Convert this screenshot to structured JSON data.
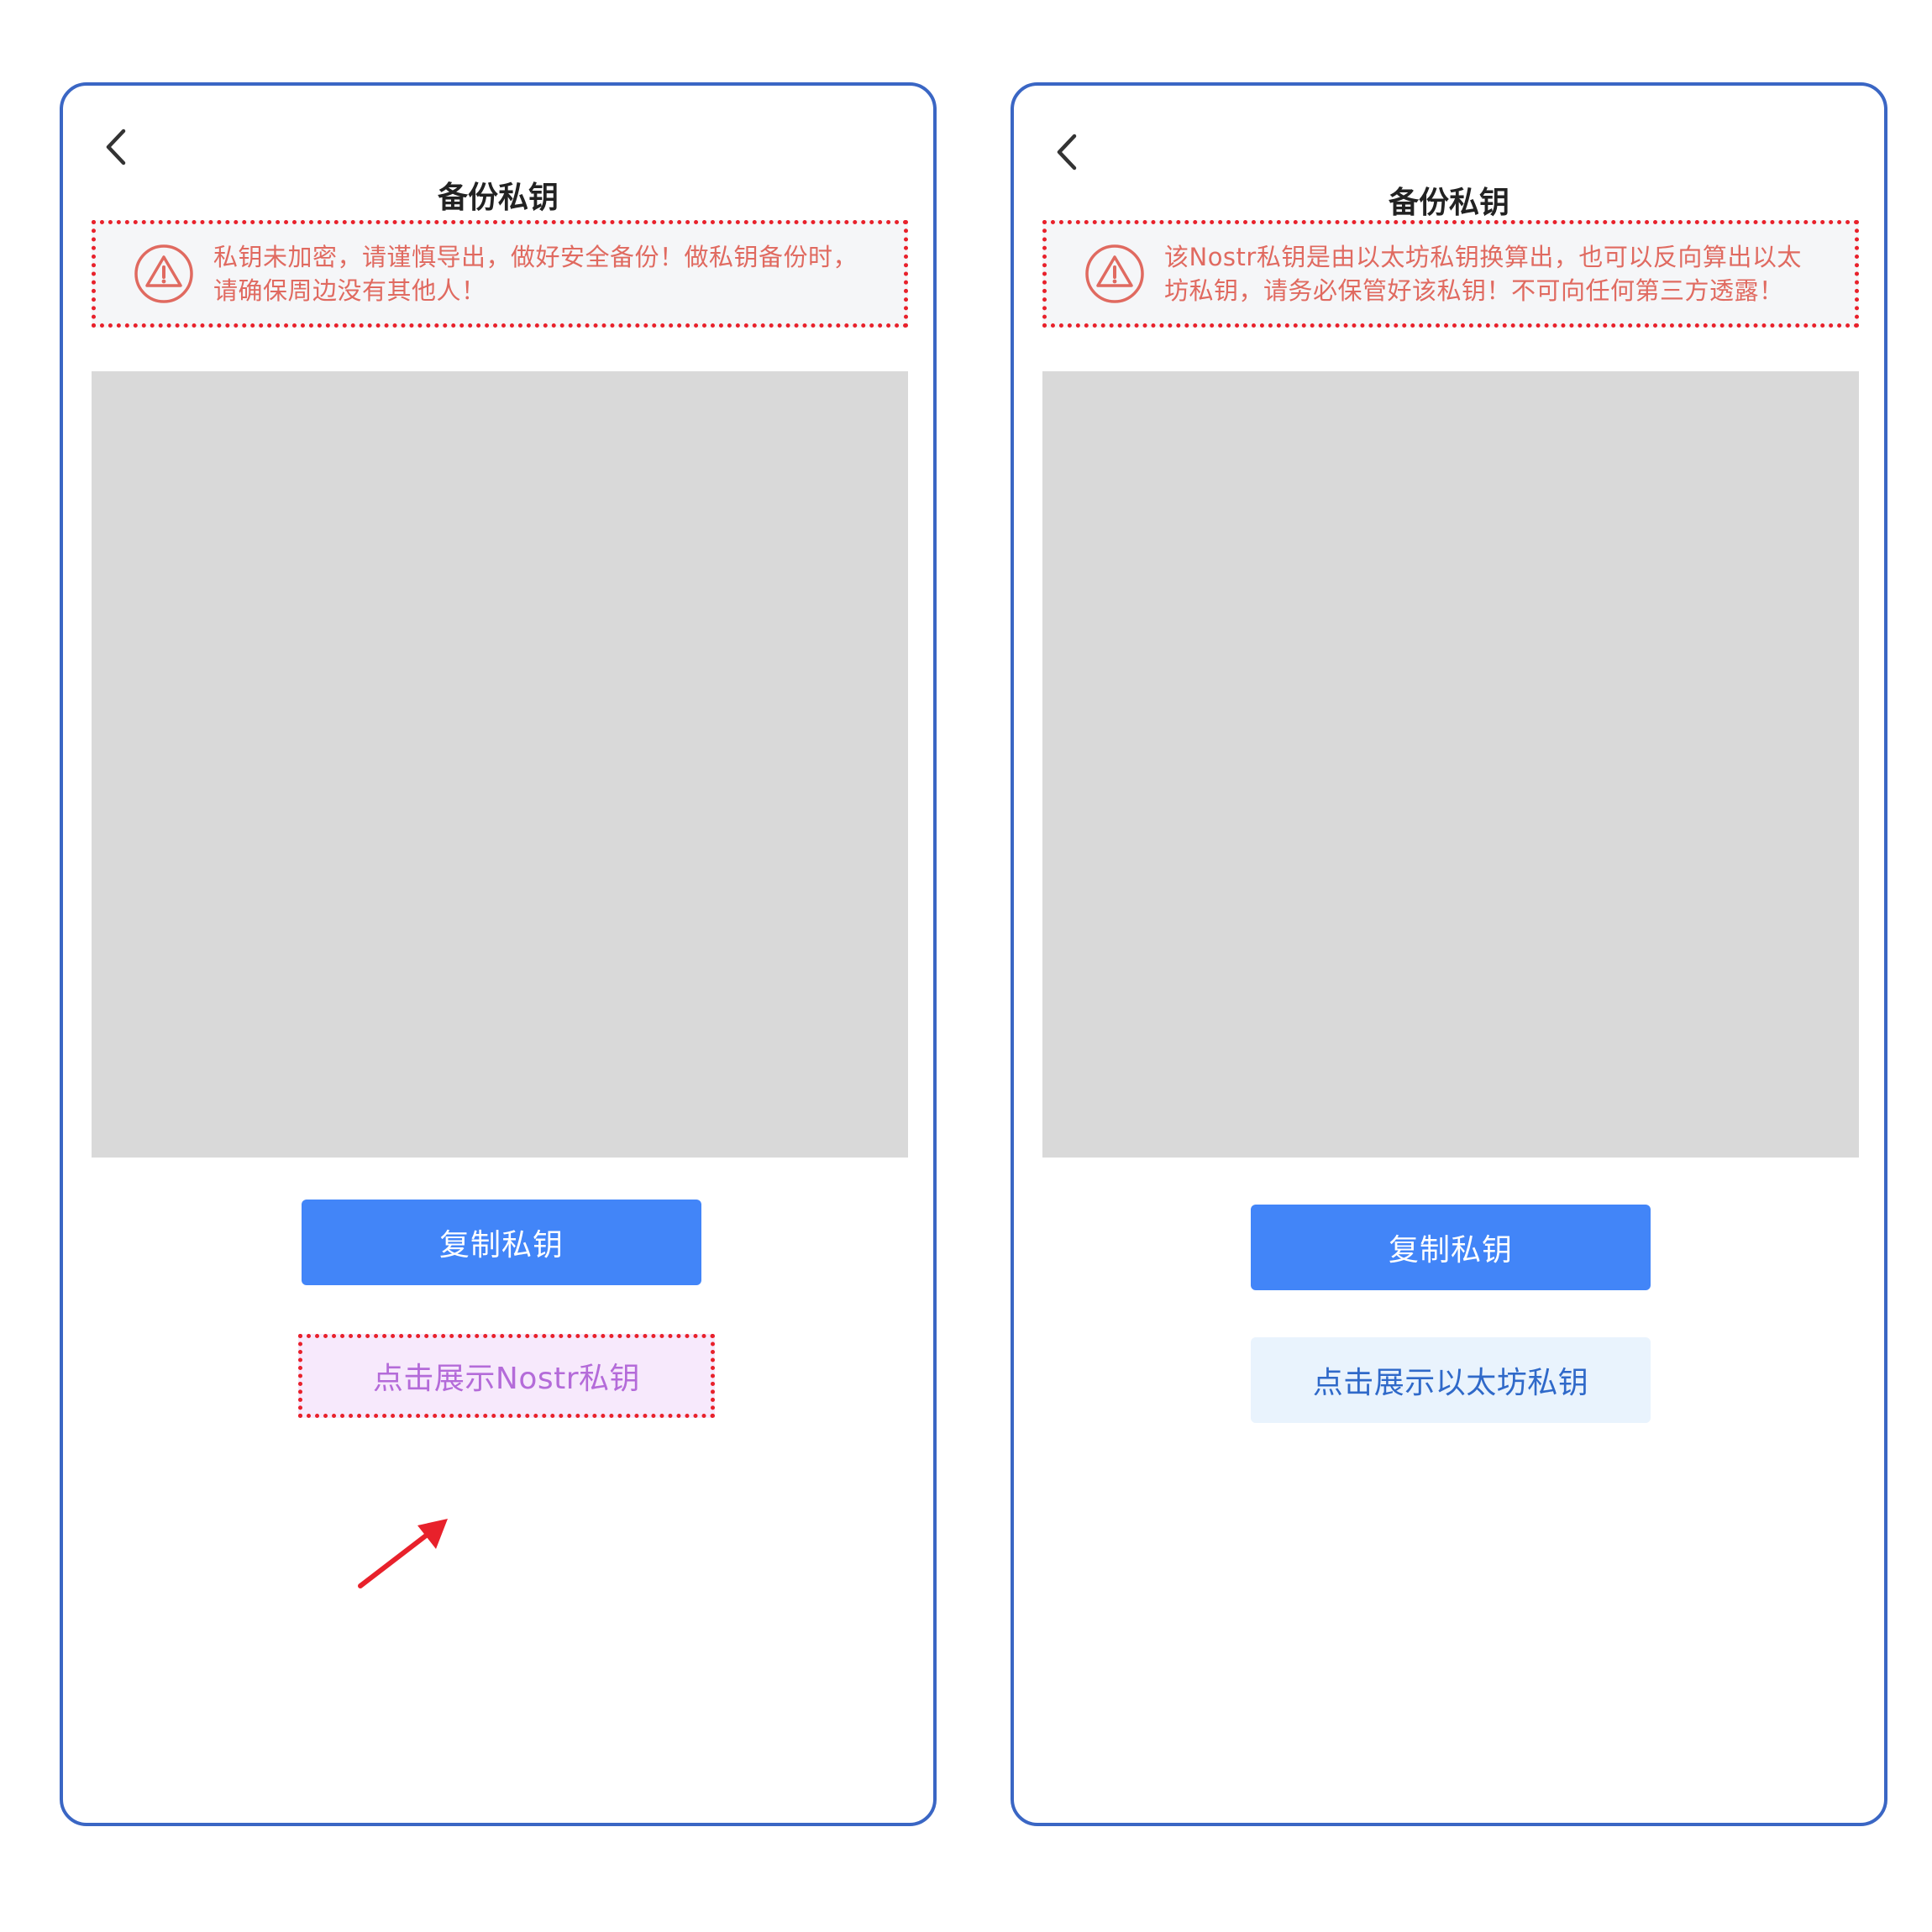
{
  "colors": {
    "phone_border": "#3a66c4",
    "warning_text": "#e06a60",
    "annotation_red": "#e8212b",
    "primary_button": "#4285f8",
    "show_button_left_text": "#b46bd9",
    "show_button_right_text": "#2f69c9",
    "key_panel": "#d9d9d9"
  },
  "screens": [
    {
      "header": {
        "title": "备份私钥",
        "back_icon": "chevron-left-icon"
      },
      "warning": {
        "icon": "warning-triangle-icon",
        "line1": "私钥未加密，请谨慎导出，做好安全备份！做私钥备份时，",
        "line2": "请确保周边没有其他人！"
      },
      "copy_button": "复制私钥",
      "show_button": "点击展示Nostr私钥"
    },
    {
      "header": {
        "title": "备份私钥",
        "back_icon": "chevron-left-icon"
      },
      "warning": {
        "icon": "warning-triangle-icon",
        "line1": "该Nostr私钥是由以太坊私钥换算出，也可以反向算出以太",
        "line2": "坊私钥，请务必保管好该私钥！不可向任何第三方透露！"
      },
      "copy_button": "复制私钥",
      "show_button": "点击展示以太坊私钥"
    }
  ]
}
